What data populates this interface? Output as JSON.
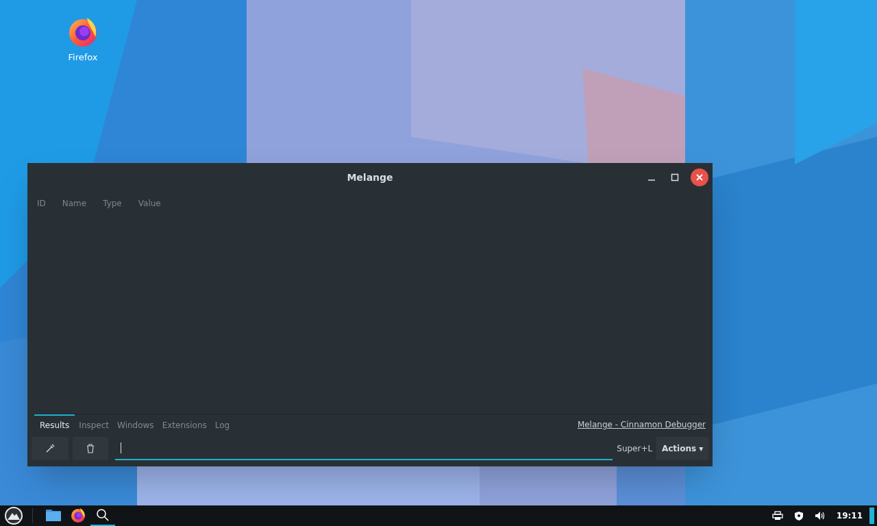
{
  "desktop_icons": [
    {
      "label": "Firefox"
    }
  ],
  "window": {
    "title": "Melange",
    "columns": [
      "ID",
      "Name",
      "Type",
      "Value"
    ],
    "tabs": [
      {
        "label": "Results",
        "selected": true
      },
      {
        "label": "Inspect",
        "selected": false
      },
      {
        "label": "Windows",
        "selected": false
      },
      {
        "label": "Extensions",
        "selected": false
      },
      {
        "label": "Log",
        "selected": false
      }
    ],
    "link": "Melange - Cinnamon Debugger",
    "shortcut": "Super+L",
    "actions_button": "Actions ▾"
  },
  "taskbar": {
    "apps": [
      {
        "kind": "files",
        "active": false
      },
      {
        "kind": "firefox",
        "active": false
      },
      {
        "kind": "search",
        "active": true
      }
    ],
    "clock": "19:11"
  }
}
